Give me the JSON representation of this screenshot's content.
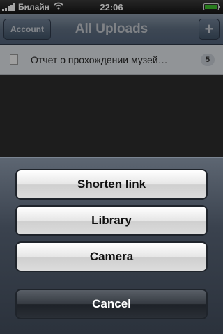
{
  "status_bar": {
    "carrier": "Билайн",
    "time": "22:06"
  },
  "nav": {
    "title": "All Uploads",
    "account_label": "Account",
    "add_label": "+"
  },
  "uploads": [
    {
      "title": "Отчет о прохождении музей…",
      "count": "5"
    }
  ],
  "action_sheet": {
    "shorten_label": "Shorten link",
    "library_label": "Library",
    "camera_label": "Camera",
    "cancel_label": "Cancel"
  },
  "colors": {
    "nav_accent": "#5f6f82",
    "battery": "#3fbf2f"
  }
}
